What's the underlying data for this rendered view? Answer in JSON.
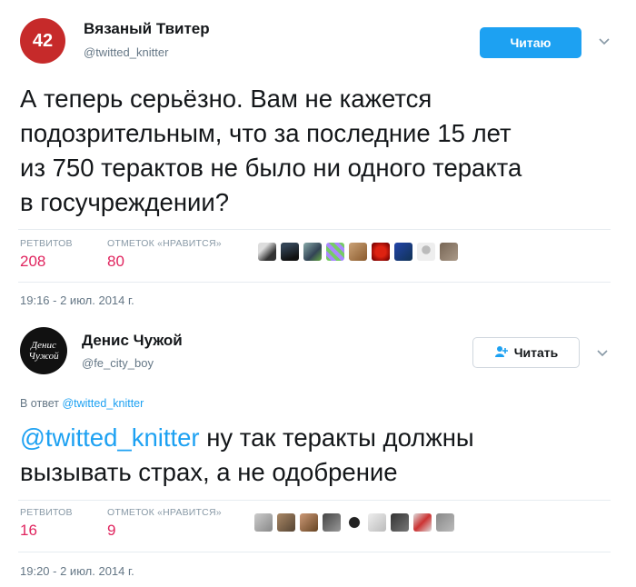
{
  "tweet1": {
    "avatar_text": "42",
    "name": "Вязаный Твитер",
    "handle": "@twitted_knitter",
    "follow_label": "Читаю",
    "text_lines": [
      "А теперь серьёзно. Вам не кажется",
      "подозрительным, что за последние 15 лет",
      "из 750 терактов не было ни одного теракта",
      "в госучреждении?"
    ],
    "retweets_label": "РЕТВИТОВ",
    "retweets_value": "208",
    "likes_label": "ОТМЕТОК «НРАВИТСЯ»",
    "likes_value": "80",
    "timestamp": "19:16 - 2 июл. 2014 г."
  },
  "tweet2": {
    "avatar_text_line1": "Денис",
    "avatar_text_line2": "Чужой",
    "name": "Денис Чужой",
    "handle": "@fe_city_boy",
    "follow_label": "Читать",
    "reply_prefix": "В ответ",
    "reply_handle": "@twitted_knitter",
    "mention": "@twitted_knitter",
    "text_line1_rest": " ну так теракты должны",
    "text_line2": "вызывать страх, а не одобрение",
    "retweets_label": "РЕТВИТОВ",
    "retweets_value": "16",
    "likes_label": "ОТМЕТОК «НРАВИТСЯ»",
    "likes_value": "9",
    "timestamp": "19:20 - 2 июл. 2014 г."
  },
  "colors": {
    "link": "#1da1f2",
    "like_count": "#e0245e",
    "follow_active_bg": "#1da1f2",
    "avatar1_bg": "#c62a2a",
    "avatar2_bg": "#111111"
  },
  "icons": {
    "chevron": "chevron-down-icon",
    "follow_person": "person-plus-icon"
  }
}
